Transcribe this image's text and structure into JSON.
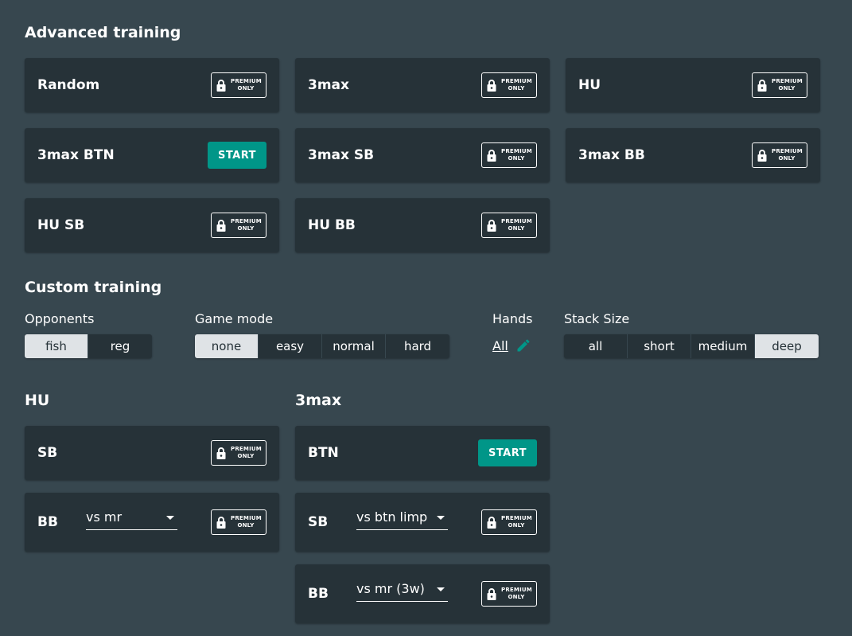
{
  "advanced": {
    "title": "Advanced training",
    "cards": [
      {
        "label": "Random",
        "action": "premium"
      },
      {
        "label": "3max",
        "action": "premium"
      },
      {
        "label": "HU",
        "action": "premium"
      },
      {
        "label": "3max BTN",
        "action": "start"
      },
      {
        "label": "3max SB",
        "action": "premium"
      },
      {
        "label": "3max BB",
        "action": "premium"
      },
      {
        "label": "HU SB",
        "action": "premium"
      },
      {
        "label": "HU BB",
        "action": "premium"
      }
    ]
  },
  "premium_label": {
    "line1": "PREMIUM",
    "line2": "ONLY"
  },
  "start_label": "START",
  "custom": {
    "title": "Custom training",
    "opponents": {
      "label": "Opponents",
      "options": [
        "fish",
        "reg"
      ],
      "selected": "fish"
    },
    "game_mode": {
      "label": "Game mode",
      "options": [
        "none",
        "easy",
        "normal",
        "hard"
      ],
      "selected": "none"
    },
    "hands": {
      "label": "Hands",
      "value": "All"
    },
    "stack_size": {
      "label": "Stack Size",
      "options": [
        "all",
        "short",
        "medium",
        "deep"
      ],
      "selected": "deep"
    }
  },
  "hu": {
    "title": "HU",
    "sb": {
      "label": "SB",
      "action": "premium"
    },
    "bb": {
      "label": "BB",
      "select_value": "vs mr",
      "action": "premium"
    }
  },
  "threemax": {
    "title": "3max",
    "btn": {
      "label": "BTN",
      "action": "start"
    },
    "sb": {
      "label": "SB",
      "select_value": "vs btn limp",
      "action": "premium"
    },
    "bb": {
      "label": "BB",
      "select_value": "vs mr (3w)",
      "action": "premium"
    }
  },
  "colors": {
    "background": "#37474f",
    "card": "#263238",
    "accent": "#009688",
    "segment_active": "#dfe3e6"
  },
  "icons": {
    "lock": "lock-icon",
    "edit": "pencil-icon",
    "dropdown": "chevron-down-icon"
  }
}
